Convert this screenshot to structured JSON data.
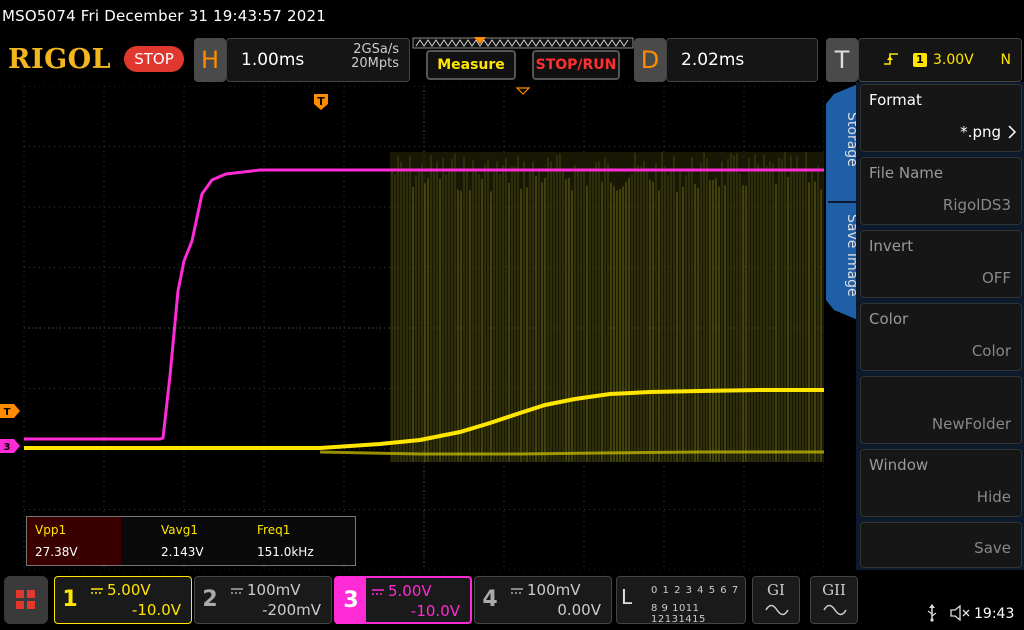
{
  "header": {
    "title": "MSO5074  Fri December 31 19:43:57 2021",
    "logo": "RIGOL",
    "run_state": "STOP"
  },
  "horizontal": {
    "letter": "H",
    "timebase": "1.00ms",
    "sample_rate": "2GSa/s",
    "memory_depth": "20Mpts"
  },
  "buttons": {
    "measure": "Measure",
    "stop_run": "STOP/RUN"
  },
  "delay": {
    "letter": "D",
    "value": "2.02ms"
  },
  "trigger": {
    "letter": "T",
    "source": "1",
    "level": "3.00V",
    "mode": "N"
  },
  "markers": {
    "trigger_time": "T",
    "trigger_level": "T",
    "ch3_ground": "3"
  },
  "measurements": [
    {
      "name": "Vpp1",
      "value": "27.38V"
    },
    {
      "name": "Vavg1",
      "value": "2.143V"
    },
    {
      "name": "Freq1",
      "value": "151.0kHz"
    }
  ],
  "side_tabs": {
    "storage": "Storage",
    "save_image": "Save Image"
  },
  "menu": [
    {
      "title": "Format",
      "value": "*.png",
      "active": true,
      "has_arrow": true
    },
    {
      "title": "File Name",
      "value": "RigolDS3",
      "active": false
    },
    {
      "title": "Invert",
      "value": "OFF",
      "active": false
    },
    {
      "title": "Color",
      "value": "Color",
      "active": false
    },
    {
      "title": "",
      "value": "NewFolder",
      "active": false
    },
    {
      "title": "Window",
      "value": "Hide",
      "active": false
    },
    {
      "title": "",
      "value": "Save",
      "active": false
    }
  ],
  "channels": [
    {
      "num": "1",
      "scale": "5.00V",
      "offset": "-10.0V",
      "color": "#ffe600",
      "active": true
    },
    {
      "num": "2",
      "scale": "100mV",
      "offset": "-200mV",
      "color": "#aaaaaa",
      "active": false
    },
    {
      "num": "3",
      "scale": "5.00V",
      "offset": "-10.0V",
      "color": "#ff2bd6",
      "active": true
    },
    {
      "num": "4",
      "scale": "100mV",
      "offset": "0.00V",
      "color": "#aaaaaa",
      "active": false
    }
  ],
  "la": {
    "letter": "L",
    "row1": "0 1 2 3  4 5 6 7",
    "row2": "8 9 1011 12131415"
  },
  "generators": [
    {
      "label": "GI"
    },
    {
      "label": "GII"
    }
  ],
  "status": {
    "time": "19:43"
  },
  "colors": {
    "ch1": "#ffe600",
    "ch3": "#ff2bd6",
    "trigger": "#ff8c00",
    "menu_bg": "#0d1a2c",
    "tab_blue": "#1e5fa8"
  }
}
